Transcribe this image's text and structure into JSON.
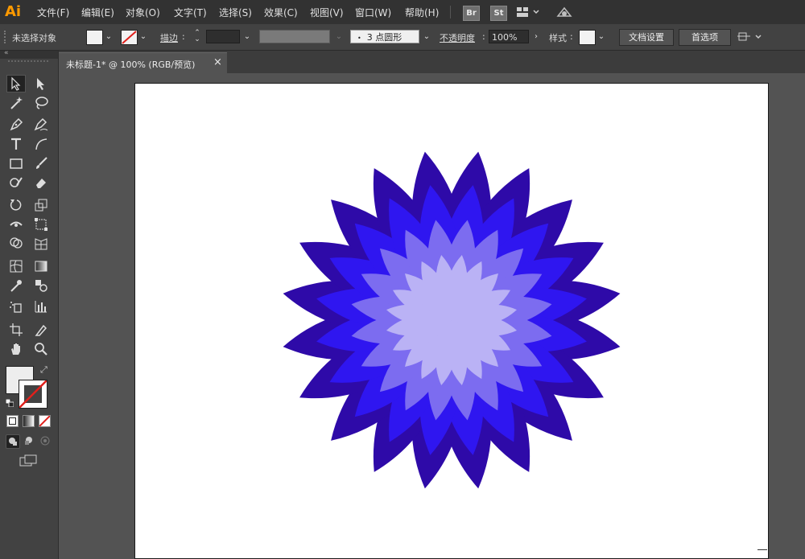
{
  "app": {
    "logo": "Ai"
  },
  "menu": [
    "文件(F)",
    "编辑(E)",
    "对象(O)",
    "文字(T)",
    "选择(S)",
    "效果(C)",
    "视图(V)",
    "窗口(W)",
    "帮助(H)"
  ],
  "badges": {
    "bridge": "Br",
    "stock": "St"
  },
  "control": {
    "selection_status": "未选择对象",
    "stroke_label": "描边",
    "brush_value": "3 点圆形",
    "opacity_label": "不透明度",
    "opacity_value": "100%",
    "style_label": "样式",
    "doc_setup": "文档设置",
    "preferences": "首选项"
  },
  "document": {
    "tab_title": "未标题-1* @ 100% (RGB/预览)",
    "close_glyph": "×"
  },
  "artwork": {
    "petal_count": 20,
    "colors": [
      "#2e0aa8",
      "#2f16f0",
      "#7c6cf0",
      "#bab2f5"
    ]
  },
  "colors": {
    "menubar": "#323232",
    "panel": "#424242",
    "workspace": "#535353",
    "accent": "#ff9a00"
  }
}
